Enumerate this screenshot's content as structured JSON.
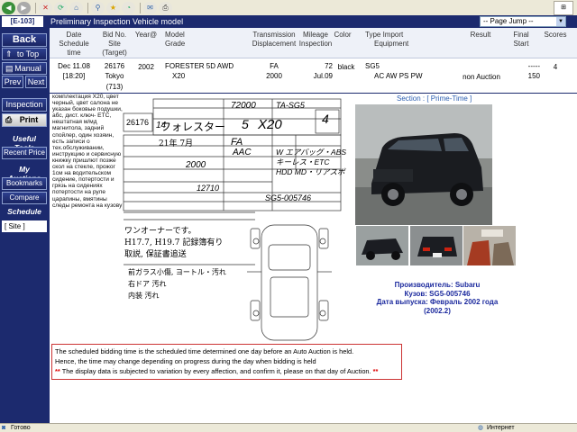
{
  "browser": {
    "buttons": [
      "back-icon",
      "forward-icon",
      "stop-icon",
      "refresh-icon",
      "home-icon",
      "search-icon",
      "favorites-icon",
      "history-icon",
      "mail-icon",
      "print-icon"
    ]
  },
  "header": {
    "lot_no": "[E-103]",
    "title": "Preliminary Inspection Vehicle model",
    "page_jump": "-- Page Jump --"
  },
  "sidebar": {
    "back": "Back",
    "to_top": "to Top",
    "manual": "Manual",
    "prev": "Prev",
    "next": "Next",
    "inspection": "Inspection",
    "print": "Print",
    "useful_tools": "Useful Tools",
    "recent_price": "Recent Price",
    "my_auctions": "My Auctions",
    "bookmarks": "Bookmarks",
    "compare": "Compare",
    "schedule": "Schedule",
    "site": "[ Site ]"
  },
  "info_table": {
    "headers": {
      "date": "Date",
      "schedule_time": "Schedule",
      "time2": "time",
      "bid_no": "Bid No.",
      "site": "Site",
      "target": "(Target)",
      "year": "Year@",
      "model": "Model",
      "grade": "Grade",
      "transmission": "Transmission",
      "displacement": "Displacement",
      "mileage": "Mileage",
      "inspection": "Inspection",
      "color": "Color",
      "type": "Type   Import",
      "equipment": "Equipment",
      "result": "Result",
      "final": "Final",
      "start": "Start",
      "scores": "Scores"
    },
    "row": {
      "date": "Dec 11.08",
      "time": "[18:20]",
      "bid_no": "26176",
      "site": "Tokyo",
      "target": "(713)",
      "year": "2002",
      "model": "FORESTER 5D AWD",
      "grade": "X20",
      "transmission": "FA",
      "displacement": "2000",
      "mileage": "72",
      "inspection": "Jul.09",
      "color": "black",
      "type": "SG5",
      "equipment": "AC AW PS PW",
      "result": "non Auction",
      "final": "-----",
      "start": "150",
      "scores": "4"
    }
  },
  "sheet": {
    "russian_text": "комплектация Х20, цвет черный, цвет салона не указан боковые подушки, абс, диcт. ключ- ETC, нештатная м/мд магнитола, задний спойлер, один хозяин, есть записи о тех.обслуживании, инструкцию и сервисную книжку пришлют позже скол на стекле, прожог 1см на водительском сидение, потертости и грязь на сидениях потертости на руле царапины, вмятины следы ремонта на кузову",
    "lot": "26176",
    "mileage_hw": "72000",
    "model_hw": "フォレスター",
    "grade_hw": "X20",
    "code_hw": "TA-SG5",
    "score_hw": "4",
    "seats": "5",
    "year_hw": "14",
    "trans_hw": "FA",
    "ac_hw": "AAC",
    "inspection_hw": "21年 7月",
    "chassis_hw": "SG5-005746",
    "engine_hw": "2000",
    "equip_hw": "W エアバッグ・ABS\nキーレス・ETC\nHDD MD・リアスポ",
    "recycle_hw": "12710",
    "notes_1": "ワンオーナーです。",
    "notes_2": "H17.7, H19.7 記録簿有り",
    "notes_3": "取説, 保証書追送",
    "notes_4": "前ガラス小傷, ヨートル・汚れ",
    "notes_5": "右ドア 汚れ",
    "notes_6": "内装 汚れ"
  },
  "right": {
    "section": "Section : [ Prime-Time ]",
    "desc": [
      "Производитель: Subaru",
      "Кузов: SG5-005746",
      "Дата выпуска: Февраль 2002 года",
      "(2002.2)"
    ]
  },
  "notice": {
    "line1": "The scheduled bidding time is the scheduled time determined one day before an Auto Auction is held.",
    "line2": "Hence, the time may change depending on progress during the day when bidding is held",
    "star": "**",
    "line3": "The display data is subjected to variation by every affection, and confirm it, please on that day of Auction."
  },
  "status": {
    "left": "Готово",
    "right": "Интернет"
  }
}
